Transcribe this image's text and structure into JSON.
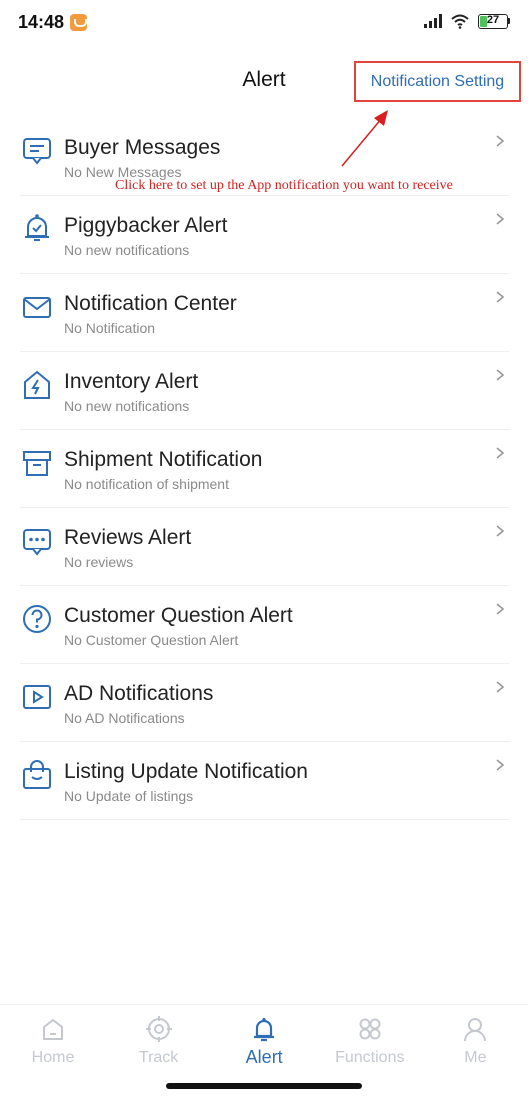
{
  "status_bar": {
    "time": "14:48",
    "battery": "27",
    "battery_level": 0.27
  },
  "header": {
    "title": "Alert",
    "setting_label": "Notification Setting"
  },
  "annotation": {
    "text": "Click here to set up the App notification you want to receive",
    "color": "#d81e1e"
  },
  "colors": {
    "accent": "#2f6eb5",
    "annotation_border": "#e0463c",
    "tab_inactive": "#c5c9cf"
  },
  "alerts": [
    {
      "title": "Buyer Messages",
      "subtitle": "No New Messages",
      "icon": "message-icon"
    },
    {
      "title": "Piggybacker Alert",
      "subtitle": "No new notifications",
      "icon": "bell-check-icon"
    },
    {
      "title": "Notification Center",
      "subtitle": "No Notification",
      "icon": "envelope-icon"
    },
    {
      "title": "Inventory Alert",
      "subtitle": "No new notifications",
      "icon": "warehouse-icon"
    },
    {
      "title": "Shipment Notification",
      "subtitle": "No notification of shipment",
      "icon": "box-icon"
    },
    {
      "title": "Reviews Alert",
      "subtitle": "No reviews",
      "icon": "chat-dots-icon"
    },
    {
      "title": "Customer Question Alert",
      "subtitle": "No Customer Question Alert",
      "icon": "question-icon"
    },
    {
      "title": "AD Notifications",
      "subtitle": "No AD Notifications",
      "icon": "play-icon"
    },
    {
      "title": "Listing Update Notification",
      "subtitle": "No Update of listings",
      "icon": "shopping-bag-icon"
    }
  ],
  "tabs": [
    {
      "label": "Home",
      "icon": "home-icon",
      "active": false
    },
    {
      "label": "Track",
      "icon": "target-icon",
      "active": false
    },
    {
      "label": "Alert",
      "icon": "bell-icon",
      "active": true
    },
    {
      "label": "Functions",
      "icon": "grid-icon",
      "active": false
    },
    {
      "label": "Me",
      "icon": "user-icon",
      "active": false
    }
  ]
}
